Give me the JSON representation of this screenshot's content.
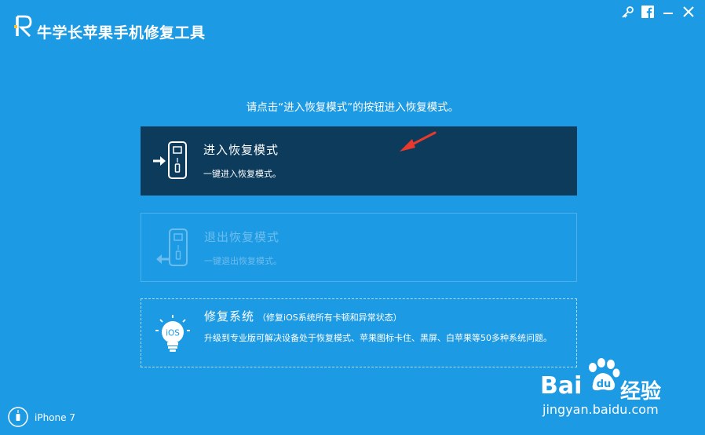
{
  "app": {
    "title": "牛学长苹果手机修复工具"
  },
  "instruction": "请点击“进入恢复模式”的按钮进入恢复模式。",
  "cards": {
    "enter": {
      "title": "进入恢复模式",
      "subtitle": "一键进入恢复模式。"
    },
    "exit": {
      "title": "退出恢复模式",
      "subtitle": "一键退出恢复模式。"
    },
    "repair": {
      "title": "修复系统",
      "note": "（修复iOS系统所有卡顿和异常状态）",
      "subtitle": "升级到专业版可解决设备处于恢复模式、苹果图标卡住、黑屏、白苹果等50多种系统问题。",
      "icon_label": "iOS"
    }
  },
  "footer": {
    "device": "iPhone 7"
  },
  "watermark": {
    "brand_left": "Bai",
    "brand_right": "经验",
    "url": "jingyan.baidu.com"
  },
  "icons": [
    "key-icon",
    "facebook-icon",
    "minimize-icon",
    "close-icon",
    "phone-enter-icon",
    "phone-exit-icon",
    "ios-bulb-icon",
    "device-connector-icon"
  ],
  "colors": {
    "background": "#1d9ae4",
    "active_card": "#0d3b5c",
    "arrow": "#e8392c"
  }
}
